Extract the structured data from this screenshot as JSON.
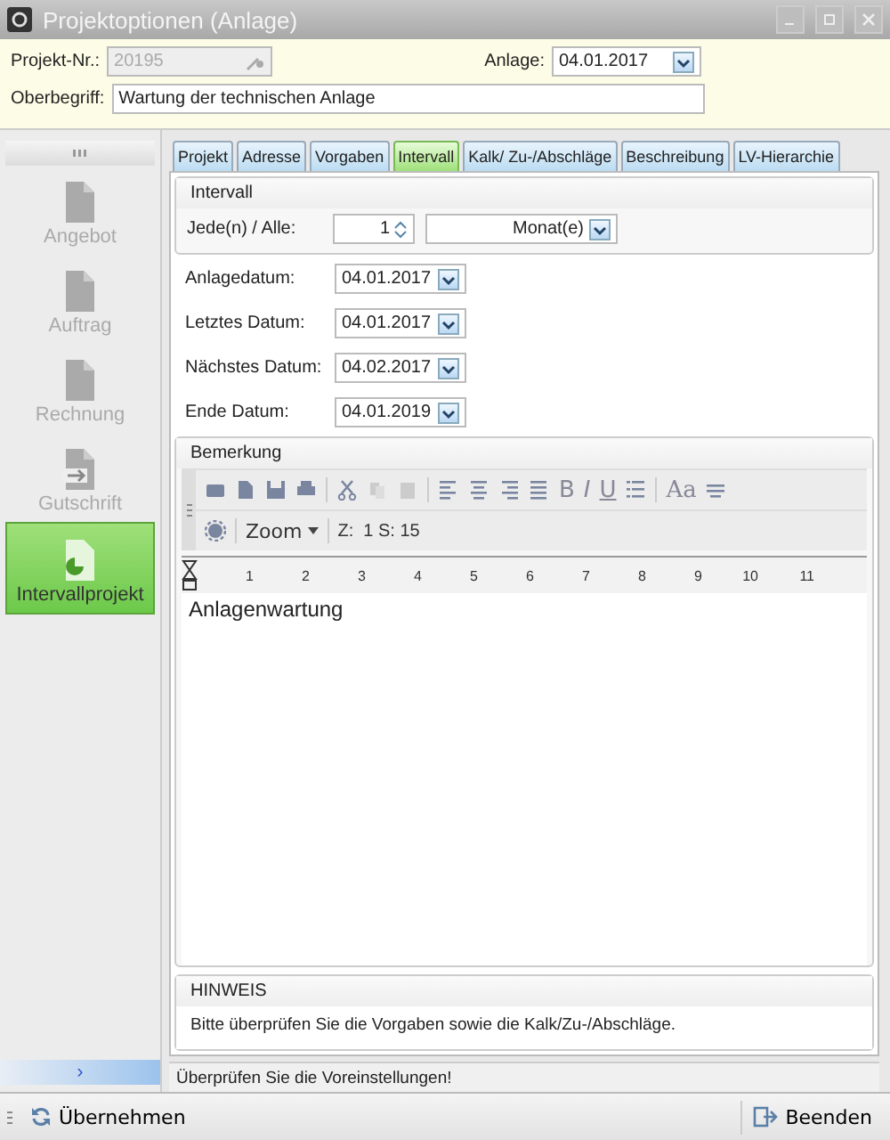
{
  "window": {
    "title": "Projektoptionen (Anlage)"
  },
  "header": {
    "project_no_label": "Projekt-Nr.:",
    "project_no": "20195",
    "anlage_label": "Anlage:",
    "anlage": "04.01.2017",
    "oberbegriff_label": "Oberbegriff:",
    "oberbegriff": "Wartung der technischen Anlage"
  },
  "sidebar": {
    "items": [
      {
        "label": "Angebot",
        "selected": false,
        "disabled": true
      },
      {
        "label": "Auftrag",
        "selected": false,
        "disabled": true
      },
      {
        "label": "Rechnung",
        "selected": false,
        "disabled": true
      },
      {
        "label": "Gutschrift",
        "selected": false,
        "disabled": true
      },
      {
        "label": "Intervallprojekt",
        "selected": true,
        "disabled": false
      }
    ],
    "expand": "›"
  },
  "tabs": [
    {
      "label": "Projekt",
      "selected": false
    },
    {
      "label": "Adresse",
      "selected": false
    },
    {
      "label": "Vorgaben",
      "selected": false
    },
    {
      "label": "Intervall",
      "selected": true
    },
    {
      "label": "Kalk/ Zu-/Abschläge",
      "selected": false
    },
    {
      "label": "Beschreibung",
      "selected": false
    },
    {
      "label": "LV-Hierarchie",
      "selected": false
    }
  ],
  "interval": {
    "title": "Intervall",
    "label": "Jede(n) / Alle:",
    "count": "1",
    "unit": "Monat(e)"
  },
  "dates": [
    {
      "label": "Anlagedatum:",
      "value": "04.01.2017"
    },
    {
      "label": "Letztes Datum:",
      "value": "04.01.2017"
    },
    {
      "label": "Nächstes Datum:",
      "value": "04.02.2017"
    },
    {
      "label": "Ende Datum:",
      "value": "04.01.2019"
    }
  ],
  "remark": {
    "title": "Bemerkung",
    "format_buttons": [
      "B",
      "I",
      "U"
    ],
    "font_button": "Aa",
    "zoom": "Zoom",
    "position": "Z:  1 S: 15",
    "ruler": [
      "1",
      "2",
      "3",
      "4",
      "5",
      "6",
      "7",
      "8",
      "9",
      "10",
      "11"
    ],
    "text": "Anlagenwartung"
  },
  "hint": {
    "title": "HINWEIS",
    "text": "Bitte überprüfen Sie die Vorgaben sowie die Kalk/Zu-/Abschläge."
  },
  "status_bar": "Überprüfen Sie die Voreinstellungen!",
  "buttons": [
    {
      "kind": "apply",
      "label": "Übernehmen"
    },
    {
      "kind": "exit",
      "label": "Beenden"
    }
  ]
}
